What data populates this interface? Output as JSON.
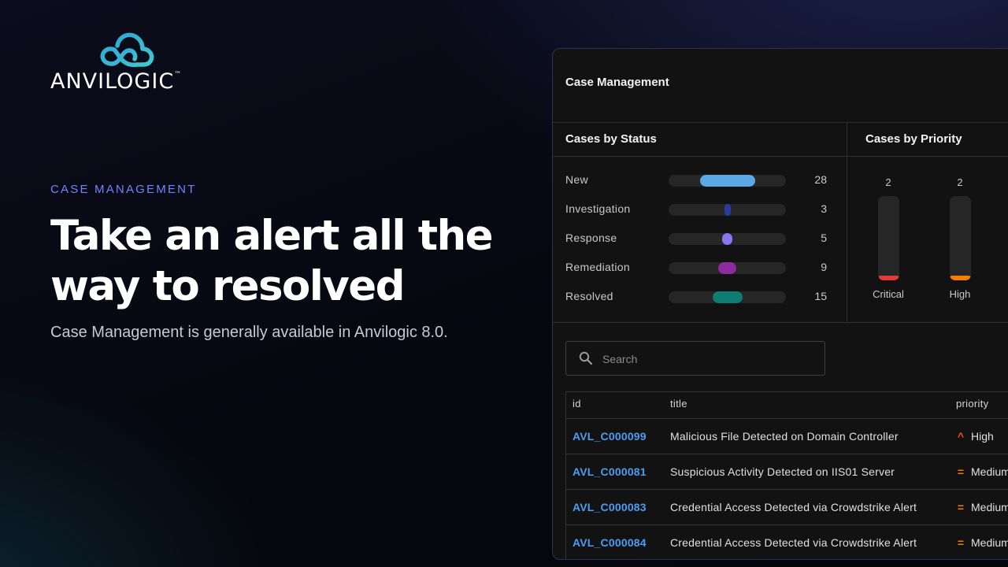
{
  "brand": {
    "name": "ANVILOGIC",
    "tm": "™",
    "logo_colors": [
      "#2fa2d6",
      "#3fcad0"
    ]
  },
  "hero": {
    "eyebrow": "CASE MANAGEMENT",
    "headline": "Take an alert all the way to resolved",
    "subline": "Case Management is generally available in Anvilogic 8.0."
  },
  "card": {
    "title": "Case Management",
    "status_panel": {
      "title": "Cases by Status",
      "max": 28,
      "rows": [
        {
          "label": "New",
          "count": 28,
          "color": "#5aa9e6"
        },
        {
          "label": "Investigation",
          "count": 3,
          "color": "#2b3b9c"
        },
        {
          "label": "Response",
          "count": 5,
          "color": "#8877ee"
        },
        {
          "label": "Remediation",
          "count": 9,
          "color": "#8e2aa0"
        },
        {
          "label": "Resolved",
          "count": 15,
          "color": "#0e7d72"
        }
      ]
    },
    "priority_panel": {
      "title": "Cases by Priority",
      "max": 2,
      "fill_fraction": 0.06,
      "columns": [
        {
          "label": "Critical",
          "count": 2,
          "color": "#e53935"
        },
        {
          "label": "High",
          "count": 2,
          "color": "#f57c00"
        }
      ]
    },
    "search": {
      "placeholder": "Search",
      "icon": "search-icon"
    },
    "table": {
      "headers": {
        "id": "id",
        "title": "title",
        "priority": "priority"
      },
      "rows": [
        {
          "id": "AVL_C000099",
          "title": "Malicious File Detected on Domain Controller",
          "priority": "High",
          "priority_icon": "^",
          "priority_color": "#f4511e"
        },
        {
          "id": "AVL_C000081",
          "title": "Suspicious Activity Detected on IIS01 Server",
          "priority": "Medium",
          "priority_icon": "=",
          "priority_color": "#f57c00"
        },
        {
          "id": "AVL_C000083",
          "title": "Credential Access Detected via Crowdstrike Alert",
          "priority": "Medium",
          "priority_icon": "=",
          "priority_color": "#f57c00"
        },
        {
          "id": "AVL_C000084",
          "title": "Credential Access Detected via Crowdstrike Alert",
          "priority": "Medium",
          "priority_icon": "=",
          "priority_color": "#f57c00"
        }
      ]
    }
  }
}
